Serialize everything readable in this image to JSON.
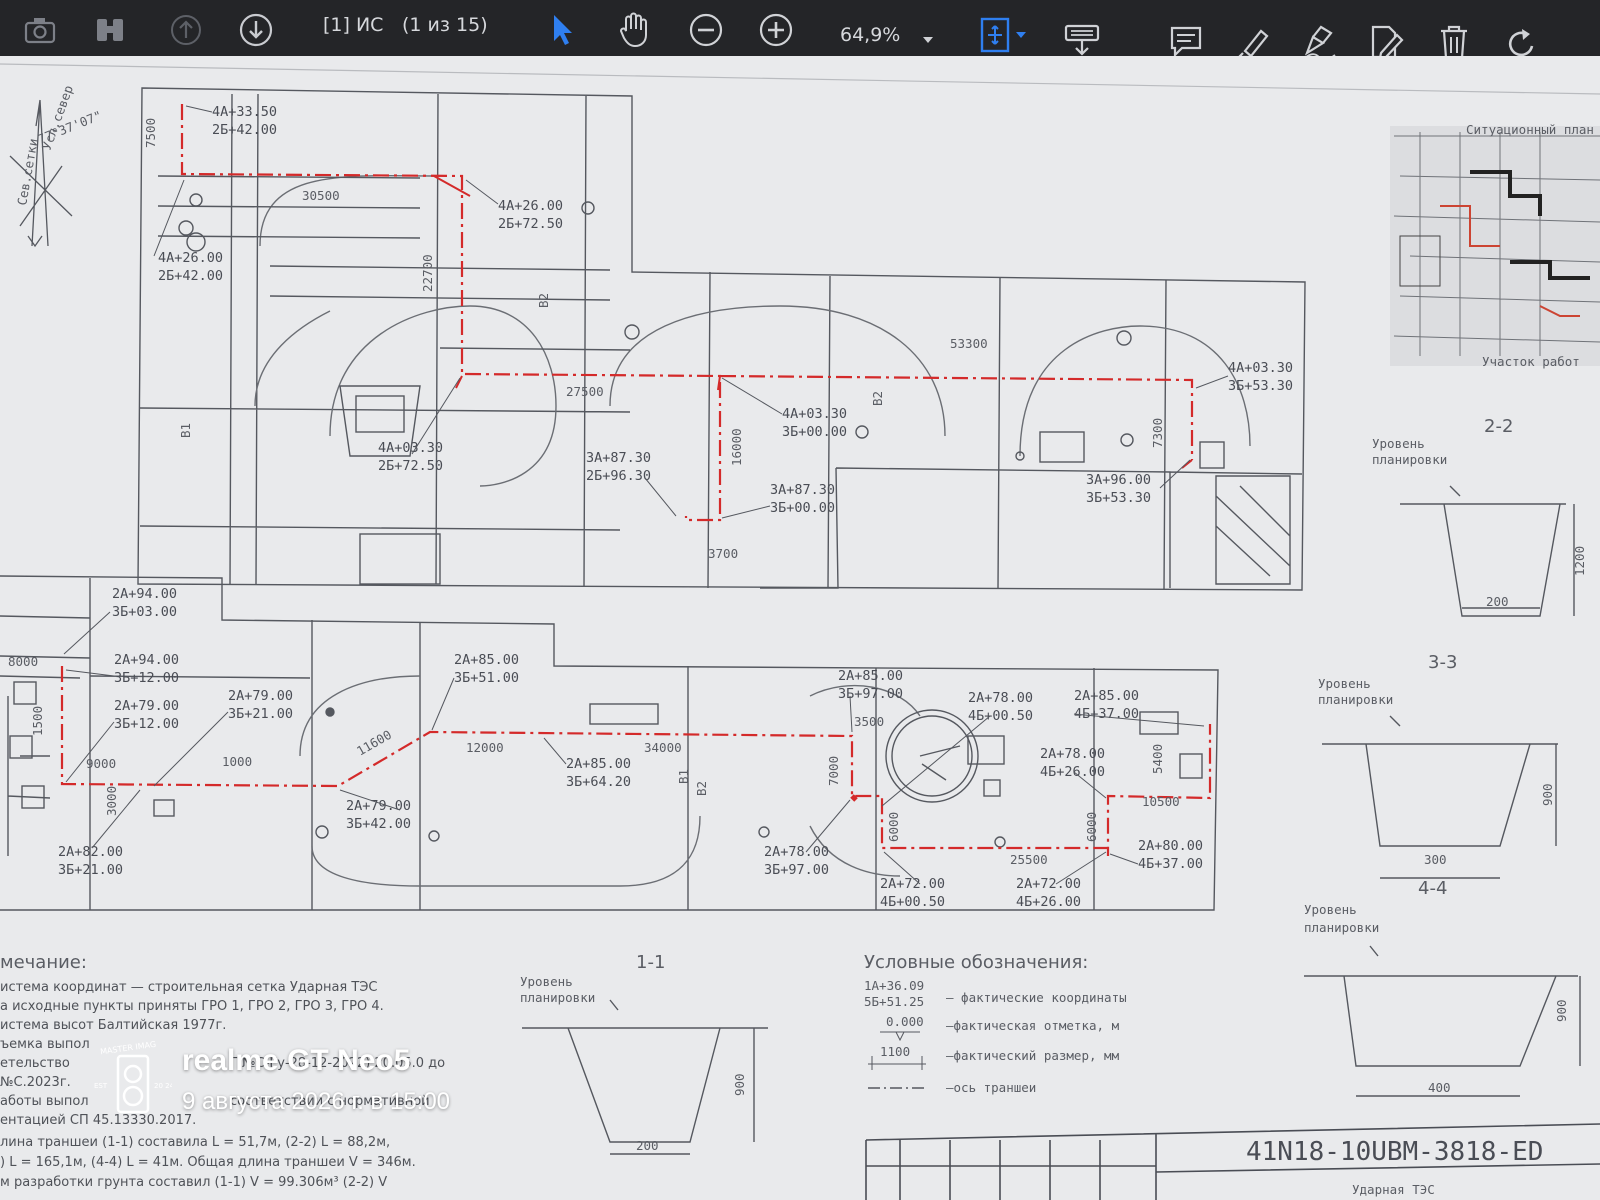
{
  "toolbar": {
    "page_label": "[1] ИС",
    "page_count": "(1 из 15)",
    "zoom": "64,9%"
  },
  "drawing": {
    "north": "Усл.север",
    "north_angle": "77°37'07\"",
    "grid_label": "Сев.сетки",
    "plan_top": [
      {
        "a": "4А+33.50",
        "b": "2Б+42.00"
      },
      {
        "a": "4А+26.00",
        "b": "2Б+72.50"
      },
      {
        "a": "4А+26.00",
        "b": "2Б+42.00"
      },
      {
        "a": "4А+03.30",
        "b": "2Б+72.50"
      },
      {
        "a": "3А+87.30",
        "b": "2Б+96.30"
      },
      {
        "a": "4А+03.30",
        "b": "3Б+00.00"
      },
      {
        "a": "3А+87.30",
        "b": "3Б+00.00"
      },
      {
        "a": "4А+03.30",
        "b": "3Б+53.30"
      },
      {
        "a": "3А+96.00",
        "b": "3Б+53.30"
      }
    ],
    "plan_bottom": [
      {
        "a": "2А+94.00",
        "b": "3Б+03.00"
      },
      {
        "a": "2А+94.00",
        "b": "3Б+12.00"
      },
      {
        "a": "2А+79.00",
        "b": "3Б+12.00"
      },
      {
        "a": "2А+79.00",
        "b": "3Б+21.00"
      },
      {
        "a": "2А+82.00",
        "b": "3Б+21.00"
      },
      {
        "a": "2А+85.00",
        "b": "3Б+51.00"
      },
      {
        "a": "2А+85.00",
        "b": "3Б+64.20"
      },
      {
        "a": "2А+79.00",
        "b": "3Б+42.00"
      },
      {
        "a": "2А+85.00",
        "b": "3Б+97.00"
      },
      {
        "a": "2А+78.00",
        "b": "3Б+97.00"
      },
      {
        "a": "2А+78.00",
        "b": "4Б+00.50"
      },
      {
        "a": "2А+85.00",
        "b": "4Б+37.00"
      },
      {
        "a": "2А+78.00",
        "b": "4Б+26.00"
      },
      {
        "a": "2А+72.00",
        "b": "4Б+00.50"
      },
      {
        "a": "2А+72.00",
        "b": "4Б+26.00"
      },
      {
        "a": "2А+80.00",
        "b": "4Б+37.00"
      }
    ],
    "dims": [
      "7500",
      "30500",
      "22700",
      "27500",
      "16000",
      "3700",
      "53300",
      "7300",
      "8000",
      "1500",
      "9000",
      "3000",
      "1000",
      "11600",
      "12000",
      "34000",
      "7000",
      "3500",
      "6000",
      "25500",
      "6000",
      "5400",
      "10500"
    ],
    "axis_labels": [
      "В1",
      "В2",
      "В2",
      "В1",
      "В2"
    ],
    "sections": {
      "s11": "1-1",
      "s22": "2-2",
      "s33": "3-3",
      "s44": "4-4",
      "level": "Уровень планировки",
      "level1": "Уровень",
      "level2": "планировки",
      "w11": "200",
      "h11": "900",
      "w22": "200",
      "h22": "1200",
      "w33": "300",
      "h33": "900",
      "w44": "400",
      "h44": "900"
    },
    "situation": {
      "title": "Ситуационный план",
      "area": "Участок работ"
    },
    "notes_title": "мечание:",
    "notes": [
      "истема координат — строительная сетка Ударная ТЭС",
      "а исходные пункты приняты ГРО 1, ГРО 2, ГРО 3, ГРО 4.",
      "истема высот Балтийская 1977г.",
      "ъемка выпол",
      "етельство",
      "№С.2023г.",
      "аботы выпол",
      "ентацией СП 45.13330.2017.",
      "лина траншеи (1-1) составила L = 51,7м, (2-2) L = 88,2м,",
      ") L = 165,1м, (4-4) L = 41м. Общая длина траншеи V = 346м.",
      "м разработки грунта составил (1-1) V = 99.306м³ (2-2) V"
    ],
    "notes_fragment": "Г №С-Гу-28-12-2022) 20.05.0 до",
    "notes_fragment2": "соответствии с нормативной",
    "legend": {
      "title": "Условные обозначения:",
      "coord_a": "1А+36.09",
      "coord_b": "5Б+51.25",
      "coord_desc": "— фактические координаты",
      "elev": "0.000",
      "elev_desc": "—фактическая отметка, м",
      "size": "1100",
      "size_desc": "—фактический размер, мм",
      "axis_desc": "—ось траншеи"
    },
    "stamp_code": "41N18-10UBM-3818-ED",
    "stamp_sub": "Ударная ТЭС"
  },
  "watermark": {
    "phone": "realme GT Neo5",
    "date": "9 августа 2026 г. в 15:00",
    "logo_text": "MASTER IMAG",
    "logo_est": "EST",
    "logo_year": "20 24"
  },
  "colors": {
    "trench": "#d42a2a",
    "line": "#55585f",
    "toolbar": "#242528",
    "accent": "#2f7ff0"
  }
}
